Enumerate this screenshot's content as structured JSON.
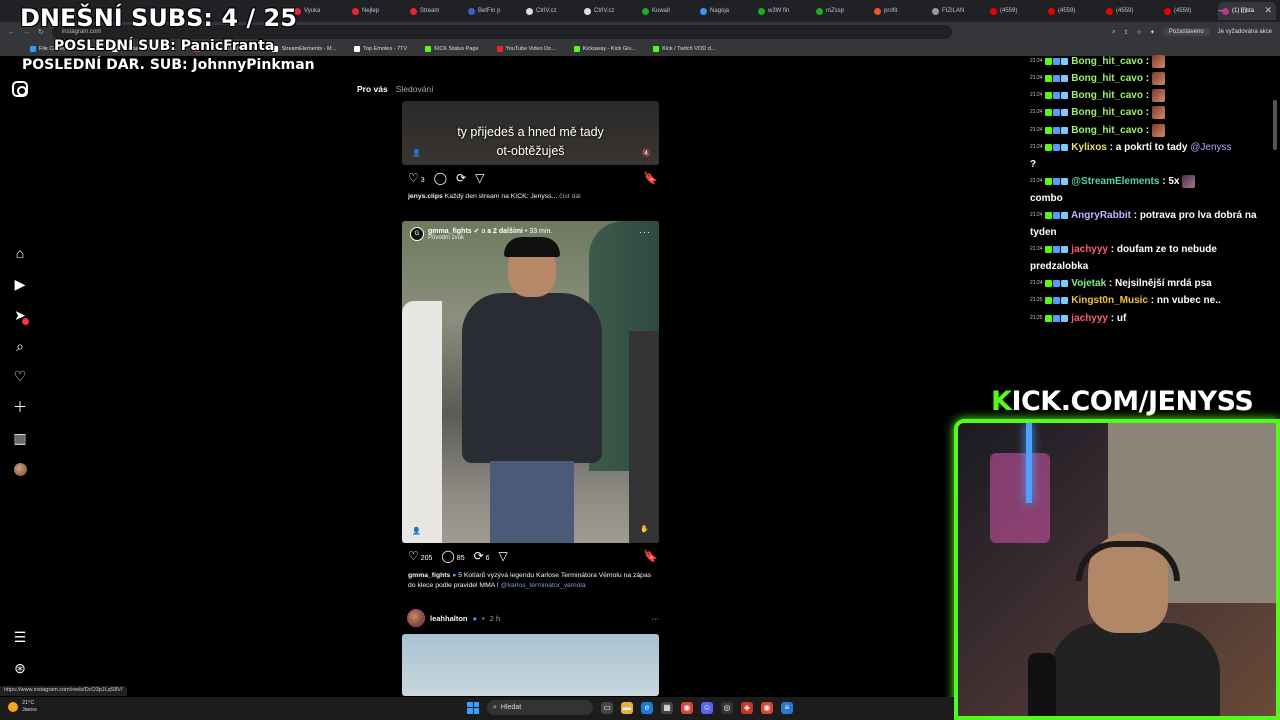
{
  "overlay": {
    "subs_line": "DNEŠNÍ SUBS: 4 / 25",
    "last_sub": "POSLEDNÍ SUB: PanicFranta",
    "last_gift": "POSLEDNÍ DAR. SUB: JohnnyPinkman"
  },
  "browser": {
    "tabs": [
      {
        "label": "Vyuka",
        "color": "#e23",
        "active": false
      },
      {
        "label": "Nejlep",
        "color": "#e23",
        "active": false
      },
      {
        "label": "Stream",
        "color": "#e23",
        "active": false
      },
      {
        "label": "BetFin p",
        "color": "#36c",
        "active": false
      },
      {
        "label": "CtrlV.cz",
        "color": "#ddd",
        "active": false
      },
      {
        "label": "CtrlV.cz",
        "color": "#ddd",
        "active": false
      },
      {
        "label": "Kuwait",
        "color": "#2a2",
        "active": false
      },
      {
        "label": "Nagoja",
        "color": "#39f",
        "active": false
      },
      {
        "label": "w3W fin",
        "color": "#2a2",
        "active": false
      },
      {
        "label": "mZssp",
        "color": "#2a2",
        "active": false
      },
      {
        "label": "profit",
        "color": "#e53",
        "active": false
      },
      {
        "label": "FIZILAN",
        "color": "#999",
        "active": false
      },
      {
        "label": "(4559)",
        "color": "#e00",
        "active": false
      },
      {
        "label": "(4559)",
        "color": "#e00",
        "active": false
      },
      {
        "label": "(4559)",
        "color": "#e00",
        "active": false
      },
      {
        "label": "(4559)",
        "color": "#e00",
        "active": false
      },
      {
        "label": "(1) Insta",
        "color": "#c13584",
        "active": true
      }
    ],
    "url": "instagram.com",
    "profile_label": "Pozastaveno",
    "action_label": "Je vyžadována akce",
    "bookmarks": [
      {
        "label": "File Converter - Free...",
        "color": "#39f"
      },
      {
        "label": "The best ChatBot an...",
        "color": "#fff"
      },
      {
        "label": "Streamer Dashboard",
        "color": "#e23"
      },
      {
        "label": "StreamElements - M...",
        "color": "#fff"
      },
      {
        "label": "Top Emotes - 7TV",
        "color": "#fff"
      },
      {
        "label": "KICK Status Page",
        "color": "#53fc18"
      },
      {
        "label": "YouTube Video Do...",
        "color": "#e23"
      },
      {
        "label": "Kickaway - Kick Giv...",
        "color": "#53fc18"
      },
      {
        "label": "Kick / Twitch VOD d...",
        "color": "#53fc18"
      }
    ]
  },
  "feed": {
    "tab_for_you": "Pro vás",
    "tab_following": "Sledování",
    "post1": {
      "subtitle_line1": "ty přijedeš a hned mě tady",
      "subtitle_line2": "ot-obtěžuješ",
      "likes": "3",
      "username": "jenys.clips",
      "caption": "Každý den stream na KICK: Jenyss...",
      "more": "číst dál"
    },
    "post2": {
      "username": "gmma_fights",
      "with_others": "a 2 dalšími",
      "time": "33 min.",
      "audio": "Původní zvuk",
      "avatar_letter": "G",
      "likes": "205",
      "comments": "85",
      "reposts": "6",
      "caption_user": "gmma_fights",
      "caption_text": "5 Kotlárů vyzývá legendu Karlose Terminátora Vémolu na zápas do klece podle pravidel MMA !",
      "caption_mention": "@karlos_terminator_vemola"
    },
    "post3": {
      "username": "leahhalton",
      "time": "2 h"
    }
  },
  "chat": {
    "messages": [
      {
        "time": "21:24",
        "user": "Bong_hit_cavo",
        "color": "#9ef06a",
        "text": "",
        "emote": true
      },
      {
        "time": "21:24",
        "user": "Bong_hit_cavo",
        "color": "#9ef06a",
        "text": "",
        "emote": true
      },
      {
        "time": "21:24",
        "user": "Bong_hit_cavo",
        "color": "#9ef06a",
        "text": "",
        "emote": true
      },
      {
        "time": "21:24",
        "user": "Bong_hit_cavo",
        "color": "#9ef06a",
        "text": "",
        "emote": true
      },
      {
        "time": "21:24",
        "user": "Bong_hit_cavo",
        "color": "#9ef06a",
        "text": "",
        "emote": true
      },
      {
        "time": "21:24",
        "user": "Kylixos",
        "color": "#e8e36a",
        "text": "a pokrtí to tady",
        "mention": "@Jenyss",
        "tail": "?"
      },
      {
        "time": "21:24",
        "user": "@StreamElements",
        "color": "#53d6a6",
        "text": "5x",
        "tail": "combo",
        "emote2": true
      },
      {
        "time": "21:24",
        "user": "AngryRabbit",
        "color": "#c2b6ff",
        "text": "potrava pro lva dobrá na tyden"
      },
      {
        "time": "21:24",
        "user": "jachyyy",
        "color": "#ff5a7a",
        "text": "doufam ze to nebude predzalobka"
      },
      {
        "time": "21:24",
        "user": "Vojetak",
        "color": "#7ff08a",
        "text": "Nejsilnější mrdá psa"
      },
      {
        "time": "21:25",
        "user": "Kingst0n_Music",
        "color": "#f0c040",
        "text": "nn vubec ne.."
      },
      {
        "time": "21:25",
        "user": "jachyyy",
        "color": "#ff5a7a",
        "text": "uf"
      }
    ]
  },
  "webcam": {
    "kick_k": "K",
    "kick_rest": "ICK.COM/JENYSS",
    "accent": "#53fc18"
  },
  "statusbar": {
    "url": "https://www.instagram.com/reels/DcO3pJLqS8V/"
  },
  "taskbar": {
    "temp": "21°C",
    "weather": "Jasno",
    "search_placeholder": "Hledat"
  }
}
